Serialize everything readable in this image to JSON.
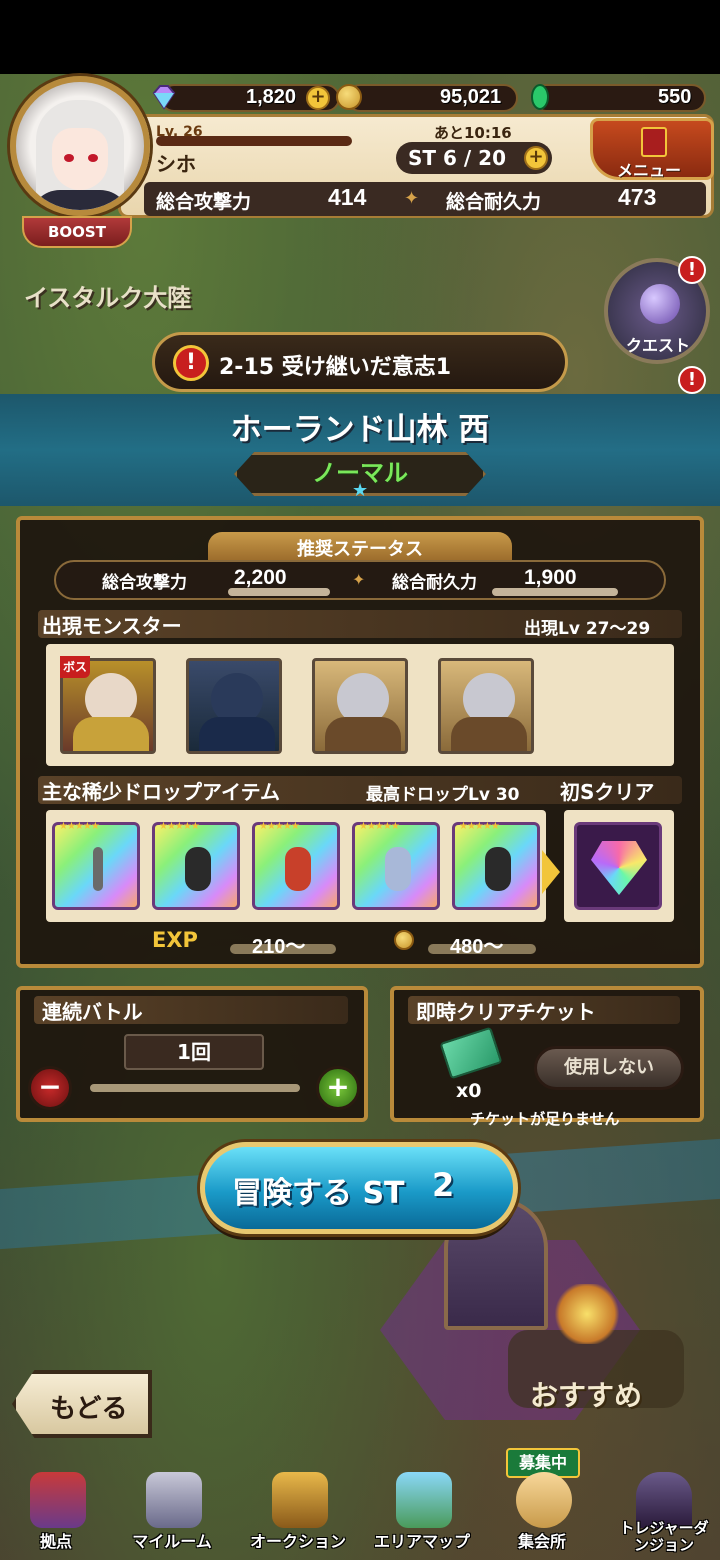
{
  "resources": {
    "gems": "1,820",
    "gold": "95,021",
    "emerald": "550"
  },
  "player": {
    "level": "Lv. 26",
    "name": "シホ",
    "boost": "BOOST",
    "st_timer": "あと10:16",
    "st": "ST  6 / 20",
    "attack_label": "総合攻撃力",
    "attack": "414",
    "defense_label": "総合耐久力",
    "defense": "473"
  },
  "menu": {
    "label": "メニュー"
  },
  "map": {
    "region": "イスタルク大陸",
    "quest_button": "クエスト",
    "alert": "!"
  },
  "quest": {
    "current": "2-15 受け継いだ意志1"
  },
  "stage": {
    "title": "ホーランド山林 西",
    "difficulty": "ノーマル",
    "star": "★"
  },
  "recommended": {
    "tab": "推奨ステータス",
    "attack_label": "総合攻撃力",
    "attack": "2,200",
    "defense_label": "総合耐久力",
    "defense": "1,900"
  },
  "monsters": {
    "label": "出現モンスター",
    "level_range": "出現Lv 27〜29",
    "boss_tag": "ボス"
  },
  "drops": {
    "label": "主な稀少ドロップアイテム",
    "max_level": "最高ドロップLv 30",
    "first_clear": "初Sクリア"
  },
  "rewards": {
    "exp_label": "EXP",
    "exp": "210〜",
    "gold": "480〜"
  },
  "continuous": {
    "label": "連続バトル",
    "count": "1回",
    "minus": "−",
    "plus": "+"
  },
  "instant": {
    "label": "即時クリアチケット",
    "count": "x0",
    "button": "使用しない",
    "note": "チケットが足りません"
  },
  "adventure": {
    "label": "冒険する ST",
    "cost": "2"
  },
  "recommend_label": "おすすめ",
  "back_label": "もどる",
  "nav": {
    "items": [
      {
        "label": "拠点"
      },
      {
        "label": "マイルーム"
      },
      {
        "label": "オークション"
      },
      {
        "label": "エリアマップ"
      },
      {
        "label": "集会所"
      },
      {
        "label": "トレジャーダンジョン"
      }
    ],
    "recruit_badge": "募集中"
  }
}
